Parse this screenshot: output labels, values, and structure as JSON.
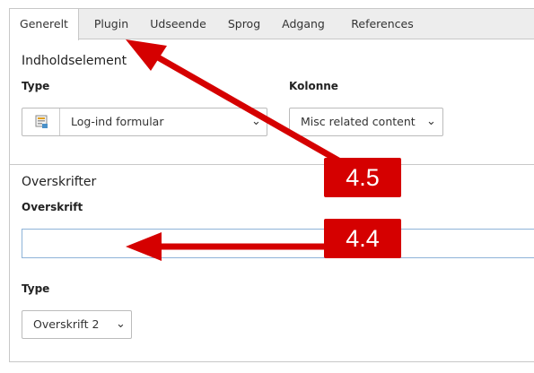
{
  "tabs": [
    {
      "label": "Generelt",
      "active": true
    },
    {
      "label": "Plugin",
      "active": false
    },
    {
      "label": "Udseende",
      "active": false
    },
    {
      "label": "Sprog",
      "active": false
    },
    {
      "label": "Adgang",
      "active": false
    },
    {
      "label": "References",
      "active": false
    }
  ],
  "content_element": {
    "section_title": "Indholdselement",
    "type_label": "Type",
    "type_value": "Log-ind formular",
    "type_icon": "login-form-icon",
    "column_label": "Kolonne",
    "column_value": "Misc related content"
  },
  "headers": {
    "section_title": "Overskrifter",
    "header_label": "Overskrift",
    "header_value": "",
    "header_type_label": "Type",
    "header_type_value": "Overskrift 2"
  },
  "annotations": [
    {
      "label": "4.5",
      "points_to": "Plugin"
    },
    {
      "label": "4.4",
      "points_to": "Overskrift"
    }
  ],
  "colors": {
    "annotation_red": "#d50000",
    "tabbar_bg": "#ededed",
    "input_border_focus": "#8eb3d8"
  },
  "icons": {
    "chevron": "chevron-down-icon"
  }
}
